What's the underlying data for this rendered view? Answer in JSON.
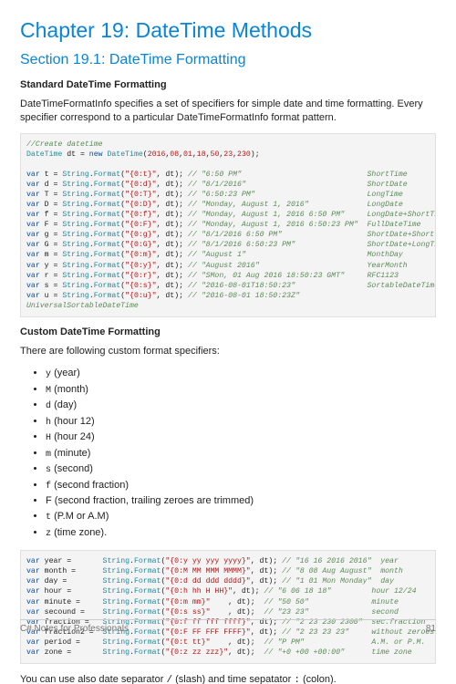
{
  "chapter_title": "Chapter 19: DateTime Methods",
  "section_title": "Section 19.1: DateTime Formatting",
  "heading_standard": "Standard DateTime Formatting",
  "intro_text": "DateTimeFormatInfo specifies a set of specifiers for simple date and time formatting. Every specifier correspond to a particular DateTimeFormatInfo format pattern.",
  "code1": {
    "create_comment": "//Create datetime",
    "dt_year": "2016",
    "dt_mo": "08",
    "dt_da": "01",
    "dt_h": "18",
    "dt_m": "50",
    "dt_s": "23",
    "dt_ms": "230",
    "rows": [
      {
        "v": "t",
        "fmt": "\"{0:t}\"",
        "cmt": "// \"6:50 PM\"",
        "name": "ShortTime"
      },
      {
        "v": "d",
        "fmt": "\"{0:d}\"",
        "cmt": "// \"8/1/2016\"",
        "name": "ShortDate"
      },
      {
        "v": "T",
        "fmt": "\"{0:T}\"",
        "cmt": "// \"6:50:23 PM\"",
        "name": "LongTime"
      },
      {
        "v": "D",
        "fmt": "\"{0:D}\"",
        "cmt": "// \"Monday, August 1, 2016\"",
        "name": "LongDate"
      },
      {
        "v": "f",
        "fmt": "\"{0:f}\"",
        "cmt": "// \"Monday, August 1, 2016 6:50 PM\"",
        "name": "LongDate+ShortTime"
      },
      {
        "v": "F",
        "fmt": "\"{0:F}\"",
        "cmt": "// \"Monday, August 1, 2016 6:50:23 PM\"",
        "name": "FullDateTime"
      },
      {
        "v": "g",
        "fmt": "\"{0:g}\"",
        "cmt": "// \"8/1/2016 6:50 PM\"",
        "name": "ShortDate+ShortTime"
      },
      {
        "v": "G",
        "fmt": "\"{0:G}\"",
        "cmt": "// \"8/1/2016 6:50:23 PM\"",
        "name": "ShortDate+LongTime"
      },
      {
        "v": "m",
        "fmt": "\"{0:m}\"",
        "cmt": "// \"August 1\"",
        "name": "MonthDay"
      },
      {
        "v": "y",
        "fmt": "\"{0:y}\"",
        "cmt": "// \"August 2016\"",
        "name": "YearMonth"
      },
      {
        "v": "r",
        "fmt": "\"{0:r}\"",
        "cmt": "// \"SMon, 01 Aug 2016 18:50:23 GMT\"",
        "name": "RFC1123"
      },
      {
        "v": "s",
        "fmt": "\"{0:s}\"",
        "cmt": "// \"2016-08-01T18:50:23\"",
        "name": "SortableDateTime"
      },
      {
        "v": "u",
        "fmt": "\"{0:u}\"",
        "cmt": "// \"2016-08-01 18:50:23Z\"",
        "name": ""
      }
    ],
    "universal": "UniversalSortableDateTime"
  },
  "heading_custom": "Custom DateTime Formatting",
  "custom_intro": "There are following custom format specifiers:",
  "bullets": [
    "y (year)",
    "M (month)",
    "d (day)",
    "h (hour 12)",
    "H (hour 24)",
    "m (minute)",
    "s (second)",
    "f (second fraction)",
    "F (second fraction, trailing zeroes are trimmed)",
    "t (P.M or A.M)",
    "z (time zone)."
  ],
  "bullets_code_idx": [
    0,
    1,
    2,
    3,
    4,
    5,
    6,
    7,
    9,
    10
  ],
  "code2": {
    "rows": [
      {
        "v": "year",
        "pad": "     ",
        "fmt": "\"{0:y yy yyy yyyy}\"",
        "c": "// \"16 16 2016 2016\"",
        "n": "year"
      },
      {
        "v": "month",
        "pad": "    ",
        "fmt": "\"{0:M MM MMM MMMM}\"",
        "c": "// \"8 08 Aug August\"",
        "n": "month"
      },
      {
        "v": "day",
        "pad": "      ",
        "fmt": "\"{0:d dd ddd dddd}\"",
        "c": "// \"1 01 Mon Monday\"",
        "n": "day"
      },
      {
        "v": "hour",
        "pad": "     ",
        "fmt": "\"{0:h hh H HH}\"",
        "c": "// \"6 06 18 18\"",
        "n": "hour 12/24"
      },
      {
        "v": "minute",
        "pad": "   ",
        "fmt": "\"{0:m mm}\"",
        "c": "// \"50 50\"",
        "n": "minute"
      },
      {
        "v": "secound",
        "pad": "  ",
        "fmt": "\"{0:s ss}\"",
        "c": "// \"23 23\"",
        "n": "second"
      },
      {
        "v": "fraction",
        "pad": " ",
        "fmt": "\"{0:f ff fff ffff}\"",
        "c": "// \"2 23 230 2300\"",
        "n": "sec.fraction"
      },
      {
        "v": "fraction2",
        "pad": "",
        "fmt": "\"{0:F FF FFF FFFF}\"",
        "c": "// \"2 23 23 23\"",
        "n": "without zeroes"
      },
      {
        "v": "period",
        "pad": "   ",
        "fmt": "\"{0:t tt}\"",
        "c": "// \"P PM\"",
        "n": "A.M. or P.M."
      },
      {
        "v": "zone",
        "pad": "     ",
        "fmt": "\"{0:z zz zzz}\"",
        "c": "// \"+0 +00 +00:00\"",
        "n": "time zone"
      }
    ]
  },
  "sep_text_prefix": "You can use also date separator ",
  "sep_slash": "/",
  "sep_text_mid": " (slash) and time sepatator ",
  "sep_colon": ":",
  "sep_text_suffix": " (colon).",
  "footer_left": "C# Notes for Professionals",
  "footer_right": "81"
}
